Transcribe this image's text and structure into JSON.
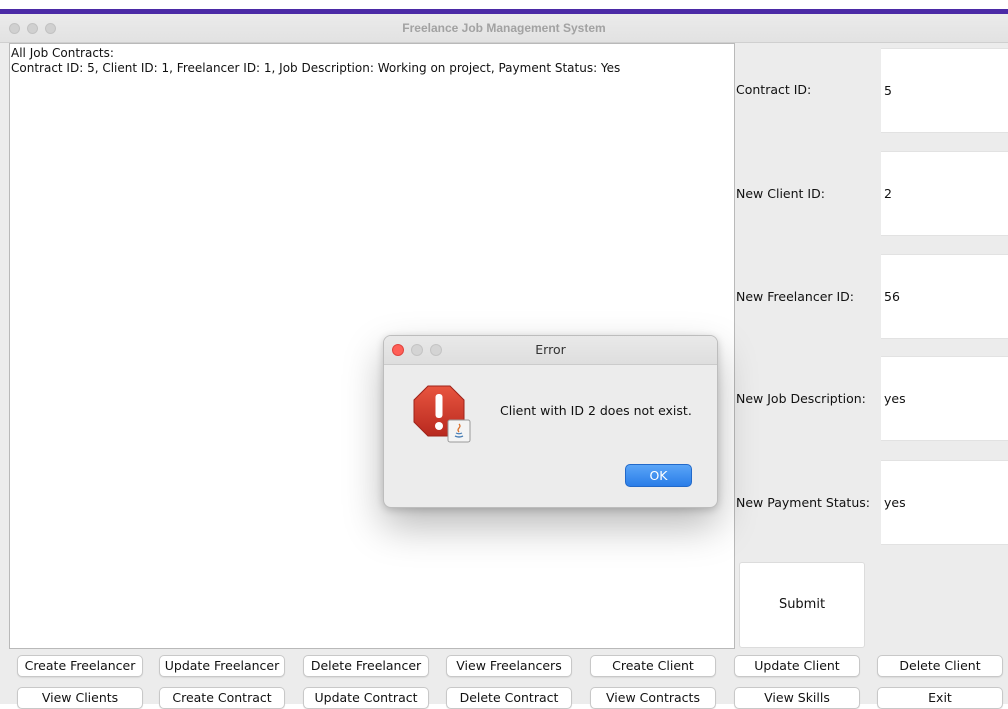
{
  "window": {
    "title": "Freelance Job Management System"
  },
  "output": {
    "lines": [
      "All Job Contracts:",
      "Contract ID: 5, Client ID: 1, Freelancer ID: 1, Job Description: Working on project, Payment Status: Yes"
    ]
  },
  "form": {
    "fields": [
      {
        "label": "Contract ID:",
        "value": "5"
      },
      {
        "label": "New Client ID:",
        "value": "2"
      },
      {
        "label": "New Freelancer ID:",
        "value": "56"
      },
      {
        "label": "New Job Description:",
        "value": "yes"
      },
      {
        "label": "New Payment Status:",
        "value": "yes"
      }
    ],
    "submit_label": "Submit"
  },
  "buttons": {
    "row1": [
      "Create Freelancer",
      "Update Freelancer",
      "Delete Freelancer",
      "View Freelancers",
      "Create Client",
      "Update Client",
      "Delete Client"
    ],
    "row2": [
      "View Clients",
      "Create Contract",
      "Update Contract",
      "Delete Contract",
      "View Contracts",
      "View Skills",
      "Exit"
    ]
  },
  "dialog": {
    "title": "Error",
    "message": "Client with ID 2 does not exist.",
    "ok_label": "OK"
  },
  "colors": {
    "accent_strip": "#4b2aa6",
    "ok_button": "#2a7de8",
    "warning_icon": "#d23a2b",
    "close_dot": "#ff5f57"
  }
}
